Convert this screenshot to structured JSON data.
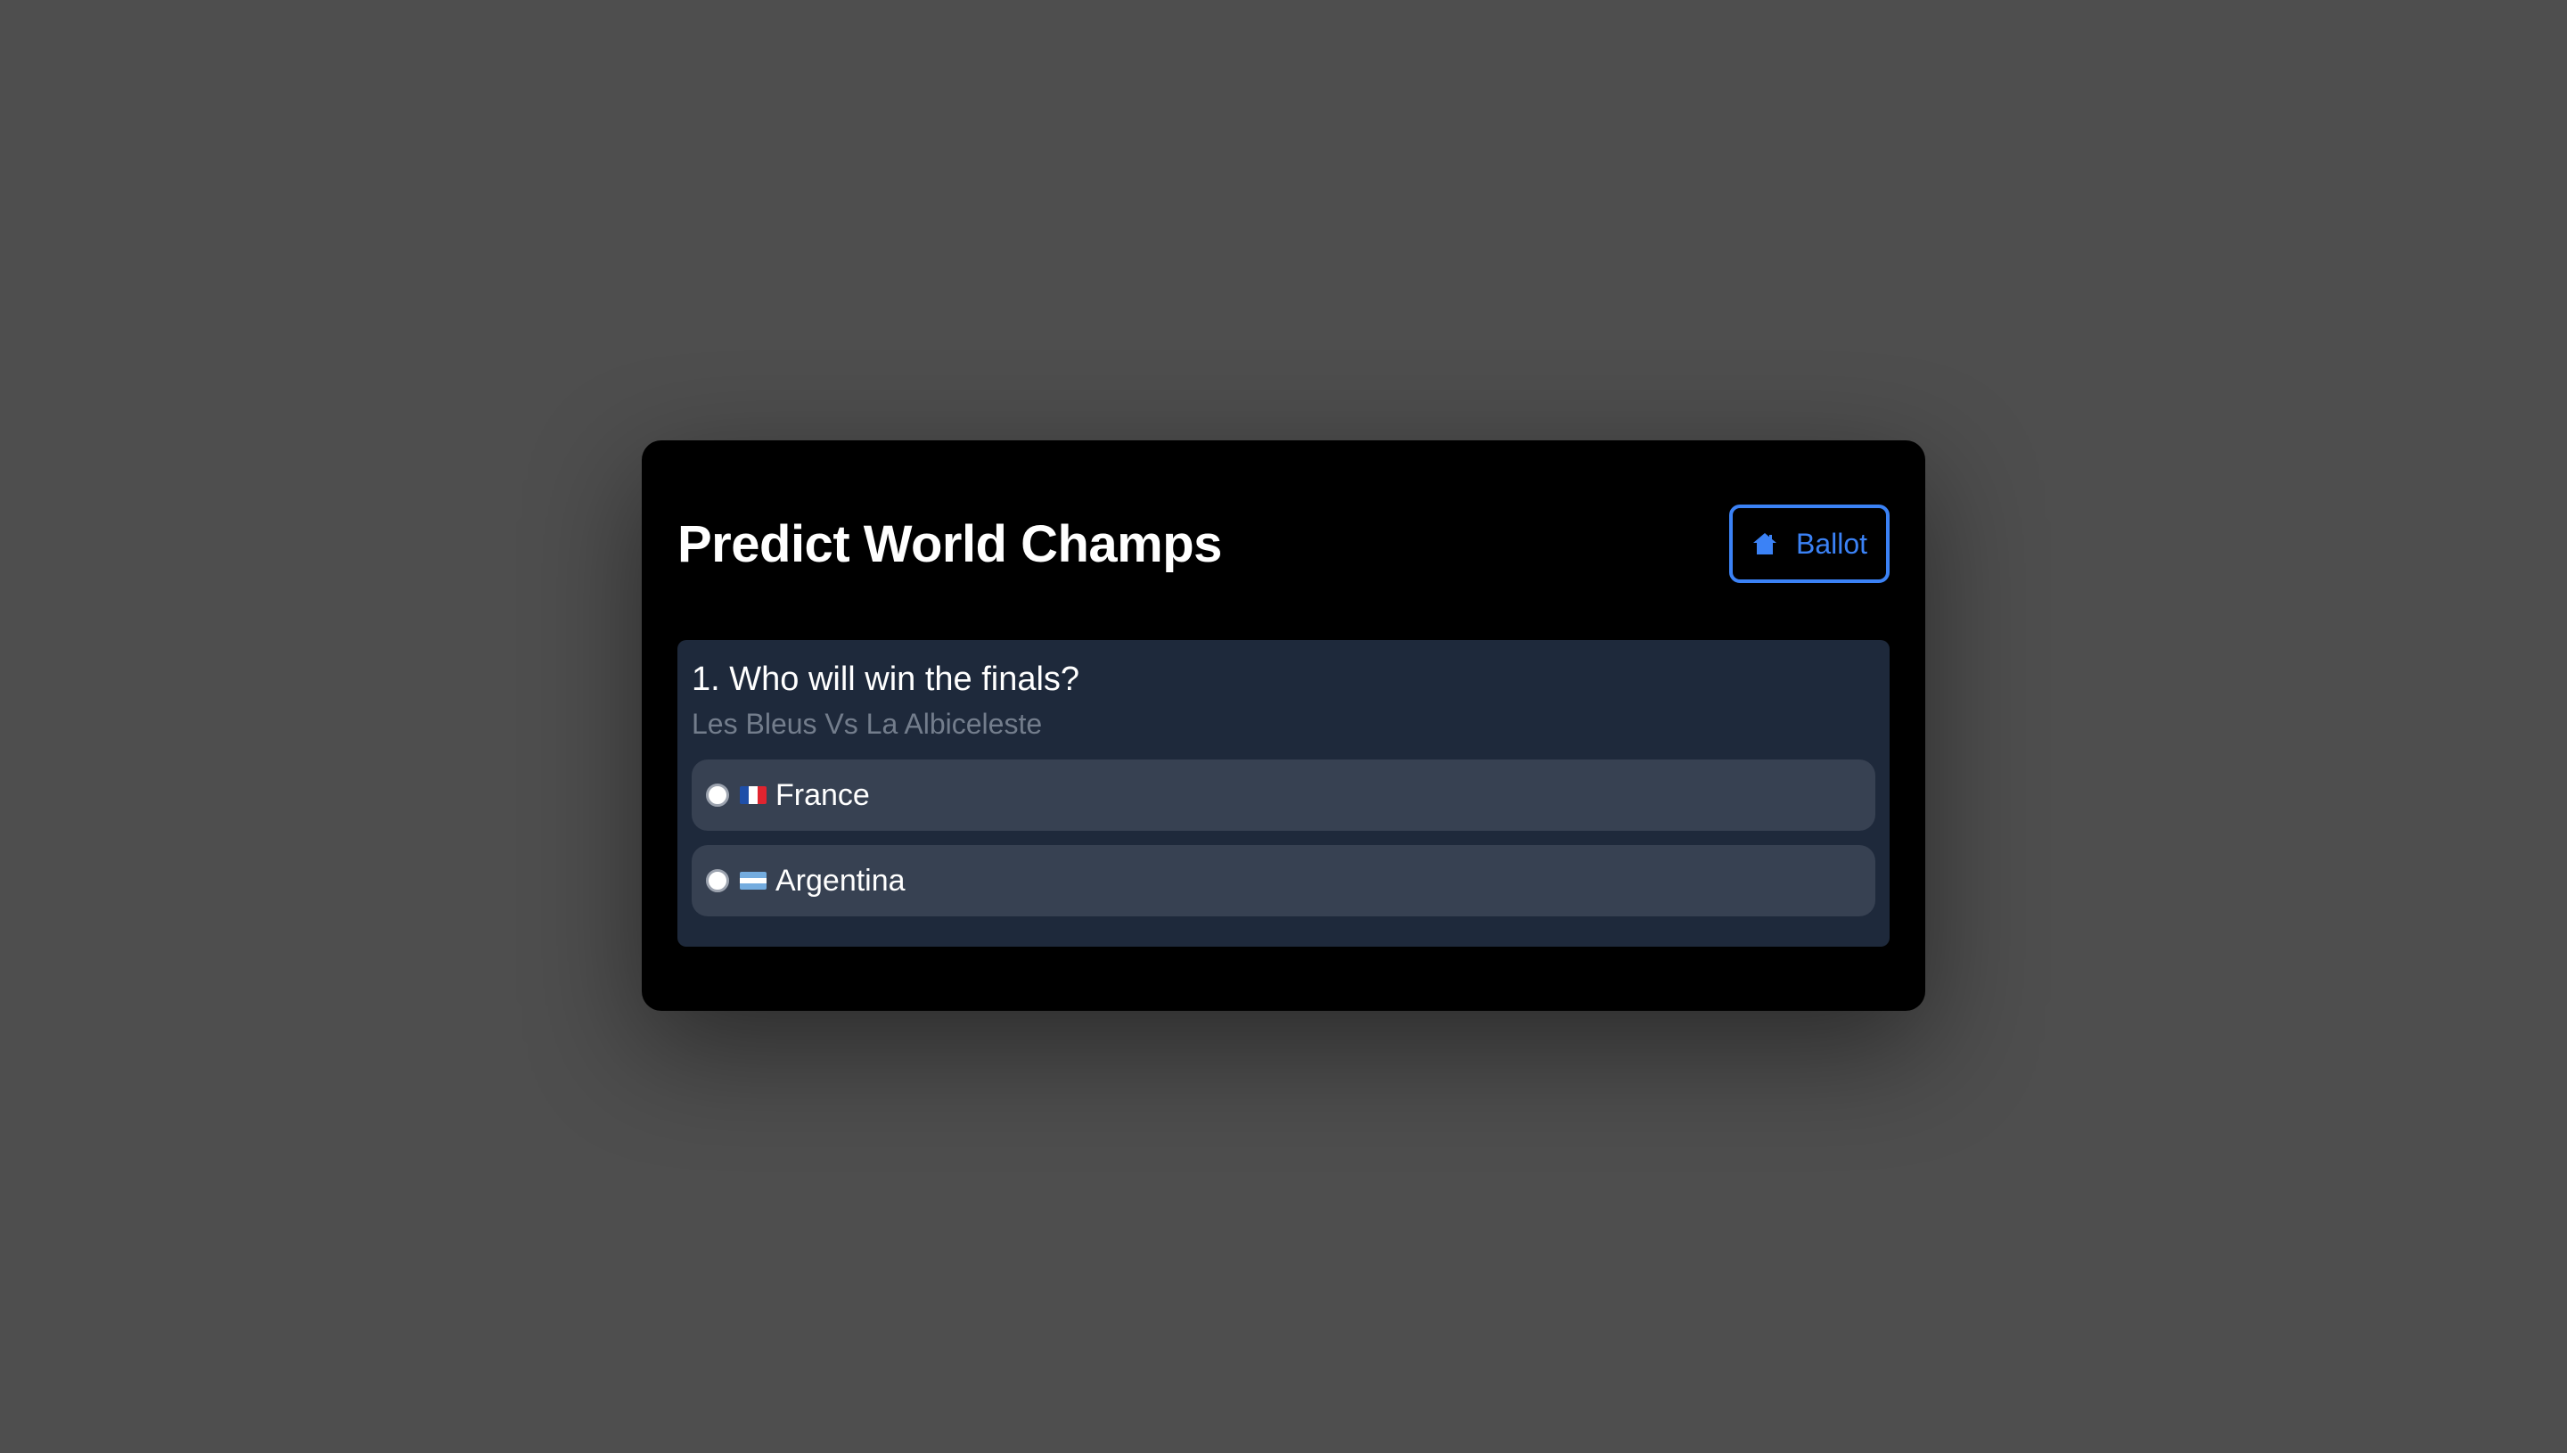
{
  "app": {
    "title": "Predict World Champs",
    "ballot_button_label": "Ballot",
    "ballot_icon": "home-icon",
    "accent_color": "#3b82f6"
  },
  "question": {
    "title": "1. Who will win the finals?",
    "subtitle": "Les Bleus Vs La Albiceleste",
    "options": [
      {
        "label": "France",
        "flag": "flag-france-icon",
        "selected": false
      },
      {
        "label": "Argentina",
        "flag": "flag-argentina-icon",
        "selected": false
      }
    ]
  }
}
